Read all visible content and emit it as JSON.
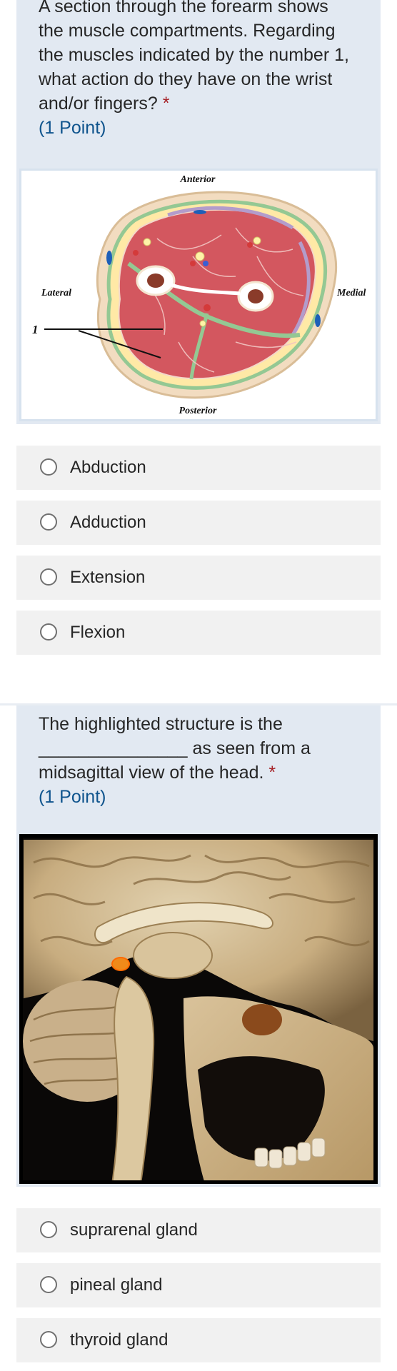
{
  "questions": [
    {
      "text": "A section through the forearm shows the muscle compartments. Regarding the muscles indicated by the number 1, what action do they have on the wrist and/or fingers?",
      "required_mark": "*",
      "points": "(1 Point)",
      "figure": {
        "labels": {
          "anterior": "Anterior",
          "posterior": "Posterior",
          "lateral": "Lateral",
          "medial": "Medial",
          "pointer": "1"
        }
      },
      "options": [
        "Abduction",
        "Adduction",
        "Extension",
        "Flexion"
      ]
    },
    {
      "text_part1": "The highlighted structure is the",
      "blank": "_______________",
      "text_part2": "as seen from a midsagittal view of the head.",
      "required_mark": "*",
      "points": "(1 Point)",
      "options": [
        "suprarenal gland",
        "pineal gland",
        "thyroid gland"
      ]
    }
  ],
  "colors": {
    "question_background": "#e2e9f2",
    "option_background": "#f1f1f1",
    "required": "#a51f24",
    "points": "#0f548d"
  }
}
